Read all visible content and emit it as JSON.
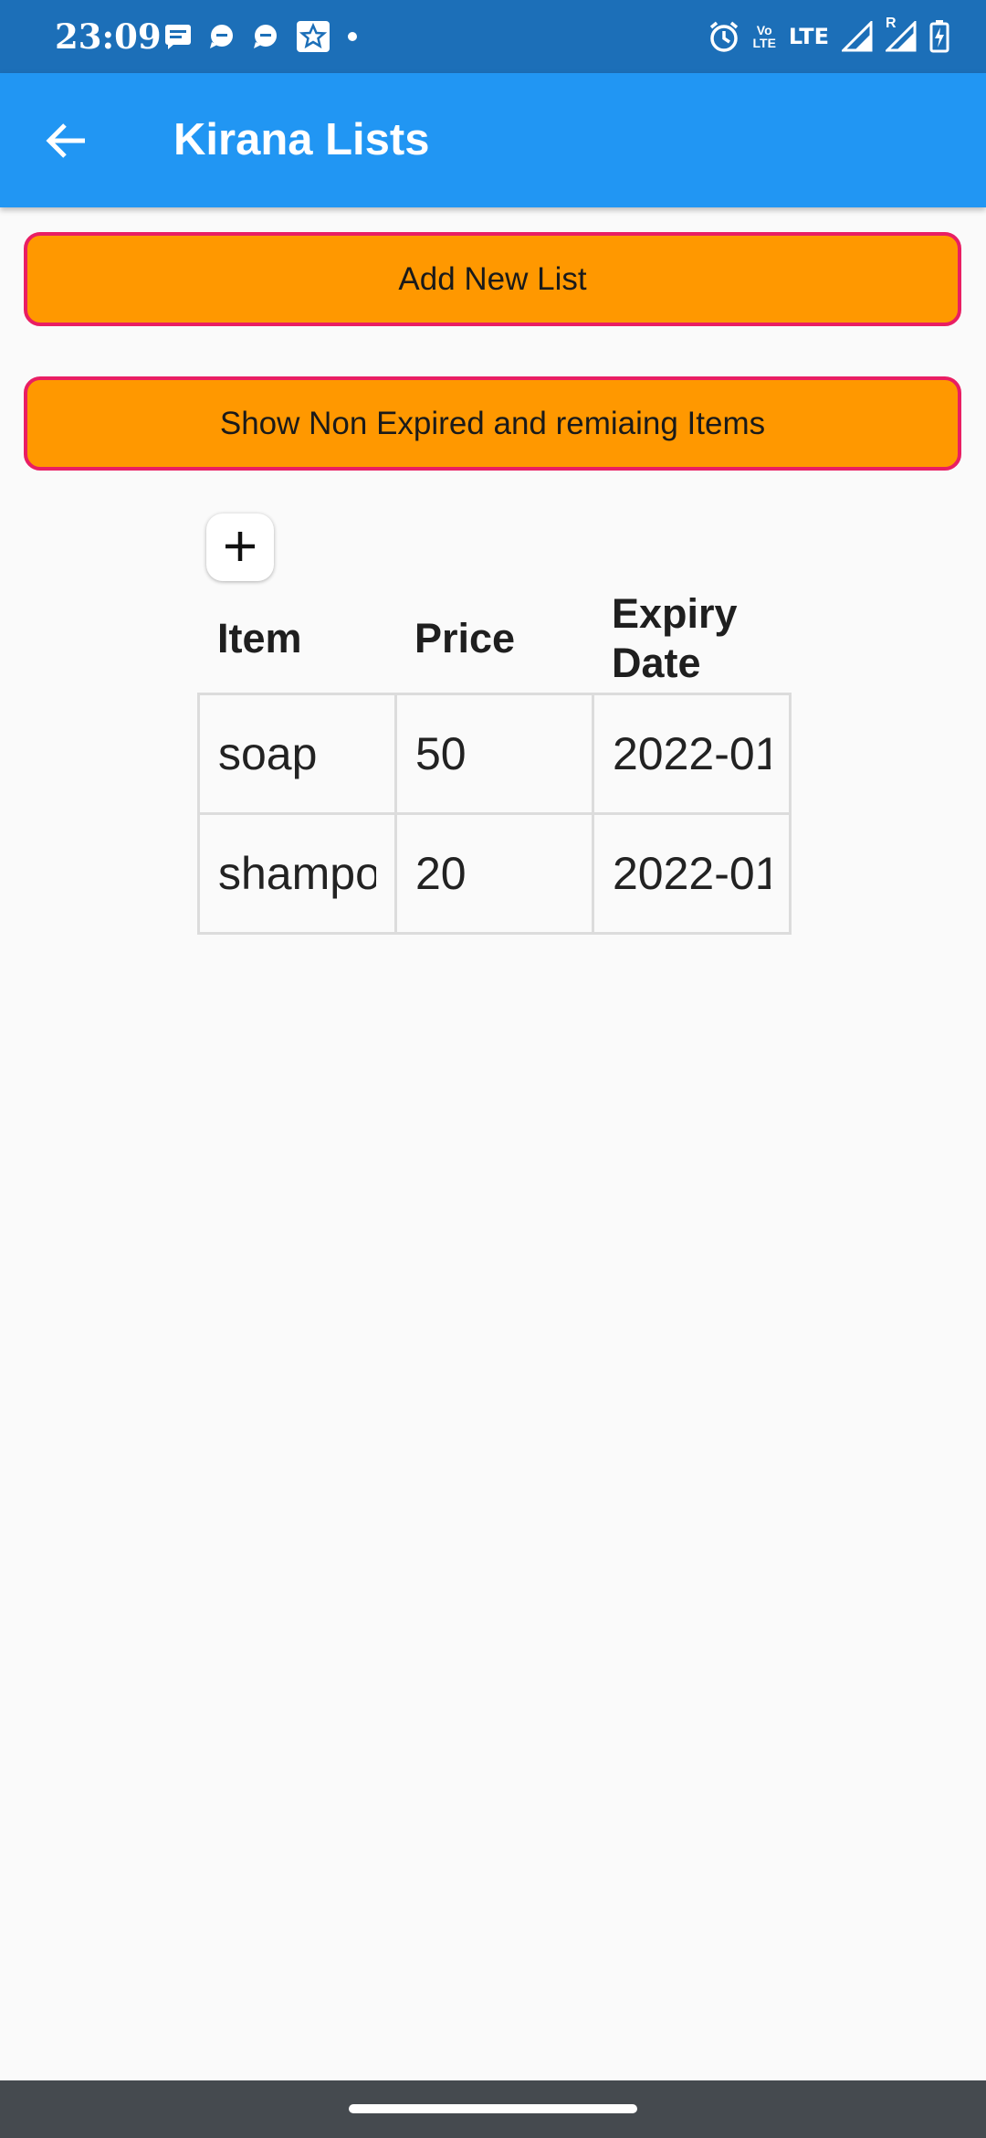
{
  "status_bar": {
    "time": "23:09",
    "left_icons": [
      "message-icon",
      "chat-bubble-icon",
      "chat-bubble-icon",
      "star-badge-icon",
      "dot-icon"
    ],
    "right_icons": [
      "alarm-icon",
      "volte-icon",
      "lte-icon",
      "signal-icon",
      "signal-roaming-icon",
      "battery-charging-icon"
    ],
    "volte_top": "Vo",
    "volte_bottom": "LTE",
    "lte_label": "LTE",
    "roaming_label": "R"
  },
  "app_bar": {
    "title": "Kirana Lists",
    "back_icon": "arrow-back-icon"
  },
  "buttons": {
    "add_new_list": "Add New List",
    "show_non_expired": "Show Non Expired and remiaing Items",
    "add_row_icon": "plus-icon"
  },
  "table": {
    "headers": {
      "item": "Item",
      "price": "Price",
      "expiry": "Expiry Date"
    },
    "rows": [
      {
        "item": "soap",
        "price": "50",
        "expiry": "2022-01"
      },
      {
        "item": "shampoo",
        "price": "20",
        "expiry": "2022-01"
      }
    ]
  },
  "colors": {
    "status_bar": "#1c6fb8",
    "app_bar": "#2196f3",
    "button_fill": "#ff9800",
    "button_border": "#e91e63",
    "background": "#fafafa",
    "nav_bar": "#454a4f"
  }
}
